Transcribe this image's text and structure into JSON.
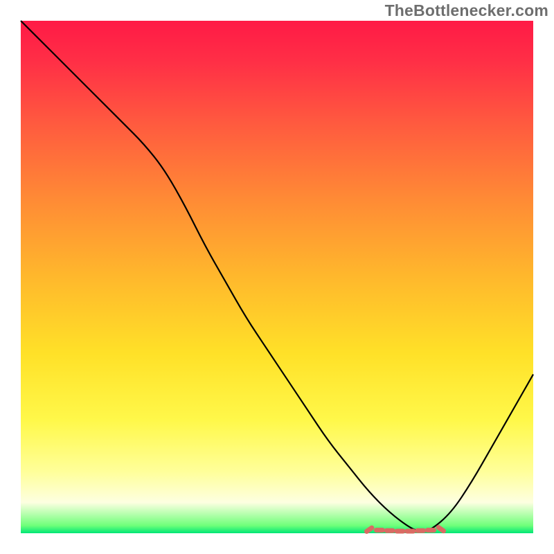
{
  "watermark": "TheBottlenecker.com",
  "chart_data": {
    "type": "line",
    "title": "",
    "xlabel": "",
    "ylabel": "",
    "xlim": [
      0,
      100
    ],
    "ylim": [
      0,
      100
    ],
    "grid": false,
    "background_gradient": {
      "stops": [
        {
          "offset": 0.0,
          "color": "#ff1a46"
        },
        {
          "offset": 0.08,
          "color": "#ff2f46"
        },
        {
          "offset": 0.2,
          "color": "#ff5a3f"
        },
        {
          "offset": 0.35,
          "color": "#ff8b35"
        },
        {
          "offset": 0.5,
          "color": "#ffb82c"
        },
        {
          "offset": 0.65,
          "color": "#ffe128"
        },
        {
          "offset": 0.78,
          "color": "#fff84a"
        },
        {
          "offset": 0.88,
          "color": "#ffff9a"
        },
        {
          "offset": 0.94,
          "color": "#fdffe1"
        },
        {
          "offset": 0.985,
          "color": "#6fff7a"
        },
        {
          "offset": 1.0,
          "color": "#00e676"
        }
      ]
    },
    "series": [
      {
        "name": "bottleneck-curve",
        "color": "#000000",
        "x": [
          0,
          4,
          8,
          12,
          16,
          20,
          24,
          28,
          32,
          36,
          40,
          44,
          48,
          52,
          56,
          60,
          64,
          68,
          72,
          76,
          78,
          80,
          84,
          88,
          92,
          96,
          100
        ],
        "y": [
          100,
          96,
          92,
          88,
          84,
          80,
          76,
          71,
          64,
          56,
          49,
          42,
          36,
          30,
          24,
          18,
          13,
          8,
          4,
          1,
          0.3,
          0.6,
          4,
          10,
          17,
          24,
          31
        ]
      },
      {
        "name": "optimal-band-markers",
        "color": "#d96b63",
        "marker": true,
        "x": [
          68,
          70,
          72,
          74,
          76,
          78,
          80,
          82
        ],
        "y": [
          0.7,
          0.6,
          0.5,
          0.4,
          0.4,
          0.5,
          0.6,
          0.8
        ]
      }
    ]
  }
}
